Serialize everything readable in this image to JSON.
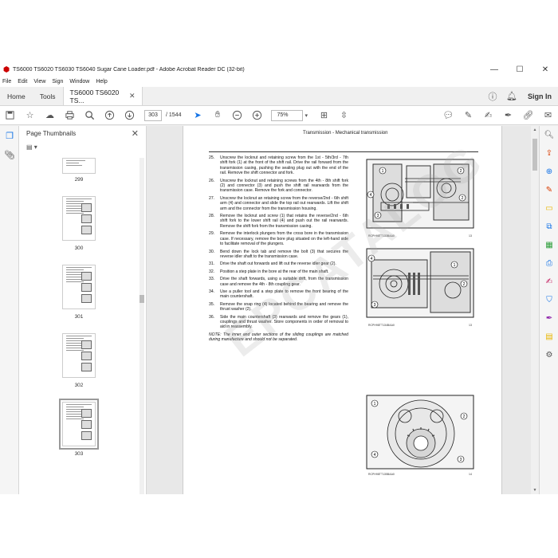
{
  "window": {
    "title": "TS6000 TS6020 TS6030 TS6040 Sugar Cane Loader.pdf - Adobe Acrobat Reader DC (32-bit)",
    "minimize": "—",
    "maximize": "☐",
    "close": "✕"
  },
  "menu": [
    "File",
    "Edit",
    "View",
    "Sign",
    "Window",
    "Help"
  ],
  "tabs": {
    "home": "Home",
    "tools": "Tools",
    "document": "TS6000 TS6020 TS...",
    "sign_in": "Sign In"
  },
  "toolbar": {
    "current_page": "303",
    "page_total": "/ 1544",
    "zoom": "75%"
  },
  "panel": {
    "title": "Page Thumbnails",
    "thumbnails": [
      {
        "label": "299",
        "selected": false
      },
      {
        "label": "300",
        "selected": false
      },
      {
        "label": "301",
        "selected": false
      },
      {
        "label": "302",
        "selected": false
      },
      {
        "label": "303",
        "selected": true
      }
    ]
  },
  "page": {
    "header": "Transmission - Mechanical transmission",
    "steps": [
      {
        "num": "25.",
        "text": "Unscrew the locknut and retaining screw from the 1st - 5th/3rd - 7th shift fork (1) at the front of the shift rail. Drive the rail forward from the transmission casing, pushing the sealing plug out with the end of the rail. Remove the shift connector and fork."
      },
      {
        "num": "26.",
        "text": "Unscrew the locknut and retaining screws from the 4th - 8th shift fork (2) and connector (3) and push the shift rail rearwards from the transmission case. Remove the fork and connector."
      },
      {
        "num": "27.",
        "text": "Unscrew the locknut an retaining screw from the reverse/2nd - 6th shift arm (4) and connector and slide the top rail out rearwards. Lift the shift arm and the connector from the transmission housing."
      },
      {
        "num": "28.",
        "text": "Remove the locknut and screw (1) that retains the reverse/2nd - 6th shift fork to the lower shift rail (4) and push out the rail rearwards. Remove the shift fork from the transmission casing."
      },
      {
        "num": "29.",
        "text": "Remove the interlock plungers from the cross bore in the transmission case. If necessary, remove the bore plug situated on the left-hand side to facilitate removal of the plungers."
      },
      {
        "num": "30.",
        "text": "Bend down the lock tab and remove the bolt (3) that secures the reverse idler shaft to the transmission case."
      },
      {
        "num": "31.",
        "text": "Drive the shaft out forwards and lift out the reverse idler gear (2)."
      },
      {
        "num": "32.",
        "text": "Position a step plate in the bore at the rear of the main shaft."
      },
      {
        "num": "33.",
        "text": "Drive the shaft forwards, using a suitable drift, from the transmission case and remove the 4th - 8th coupling gear."
      },
      {
        "num": "34.",
        "text": "Use a puller tool and a step plate to remove the front bearing of the main countershaft."
      },
      {
        "num": "35.",
        "text": "Remove the snap ring (4) located behind the bearing and remove the thrust washer (2)."
      },
      {
        "num": "36.",
        "text": "Side the main countershaft (3) rearwards and remove the gears (1), couplings and thrust washer. Store components in order of removal to aid in reassembly."
      }
    ],
    "note": "NOTE: The inner and outer sections of the sliding couplings are matched during manufacture and should not be separated.",
    "figures": [
      {
        "caption": "RCPH98TT133BAA0",
        "number": "13",
        "callouts": [
          "1",
          "2",
          "2",
          "3",
          "4"
        ]
      },
      {
        "caption": "RCPH98TT134BAA0",
        "number": "13",
        "callouts": [
          "1",
          "2",
          "3",
          "4"
        ]
      },
      {
        "caption": "RCPH98TT135BAA0",
        "number": "14",
        "callouts": [
          "1",
          "2",
          "3",
          "4"
        ]
      }
    ],
    "watermark": "EPCATALOG"
  },
  "colors": {
    "accent": "#1473e6",
    "pdf_red": "#cc0000"
  }
}
